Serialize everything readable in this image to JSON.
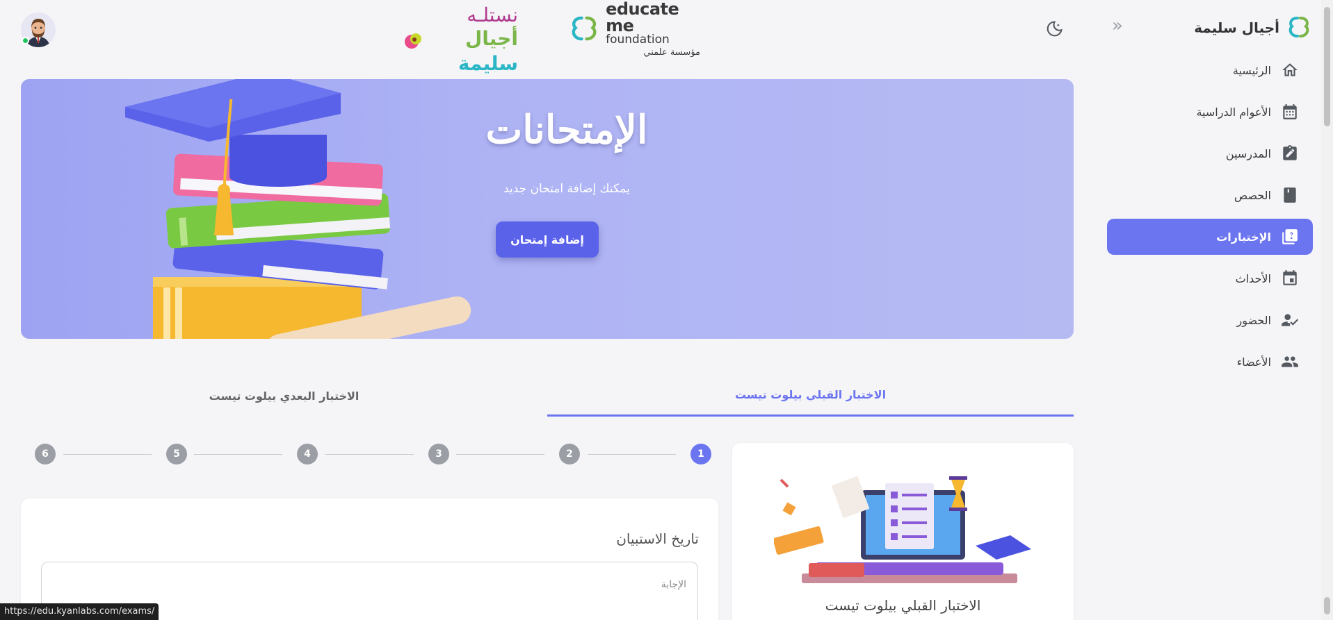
{
  "brand": {
    "name": "أجيال سليمة"
  },
  "header": {
    "educate_line1": "educate me",
    "educate_line2": "foundation",
    "educate_line3": "مؤسسة علمني",
    "nastela_line1": "نستلـه",
    "nastela_line2_a": "أجيال",
    "nastela_line2_b": "سليمة"
  },
  "sidebar": {
    "items": [
      {
        "label": "الرئيسية",
        "icon": "home-icon"
      },
      {
        "label": "الأعوام الدراسية",
        "icon": "calendar-icon"
      },
      {
        "label": "المدرسين",
        "icon": "assignment-edit-icon"
      },
      {
        "label": "الحصص",
        "icon": "book-icon"
      },
      {
        "label": "الإختبارات",
        "icon": "quiz-icon",
        "active": true
      },
      {
        "label": "الأحداث",
        "icon": "event-icon"
      },
      {
        "label": "الحضور",
        "icon": "person-check-icon"
      },
      {
        "label": "الأعضاء",
        "icon": "group-icon"
      }
    ]
  },
  "hero": {
    "title": "الإمتحانات",
    "subtitle": "يمكنك إضافة امتحان جديد",
    "button": "إضافة إمتحان"
  },
  "tabs": {
    "pre": "الاختبار القبلي بيلوت تيست",
    "post": "الاختبار البعدي بيلوت تيست"
  },
  "stepper": {
    "steps": [
      "1",
      "2",
      "3",
      "4",
      "5",
      "6"
    ],
    "active": "1"
  },
  "info_card": {
    "title": "الاختبار القبلي بيلوت تيست"
  },
  "question": {
    "label": "تاريخ الاستبيان",
    "placeholder": "الإجابة"
  },
  "status_bar": {
    "url": "https://edu.kyanlabs.com/exams/"
  },
  "colors": {
    "accent": "#6c75f0",
    "hero_bg": "#aeb3f4",
    "step_inactive": "#9b9ea4"
  }
}
